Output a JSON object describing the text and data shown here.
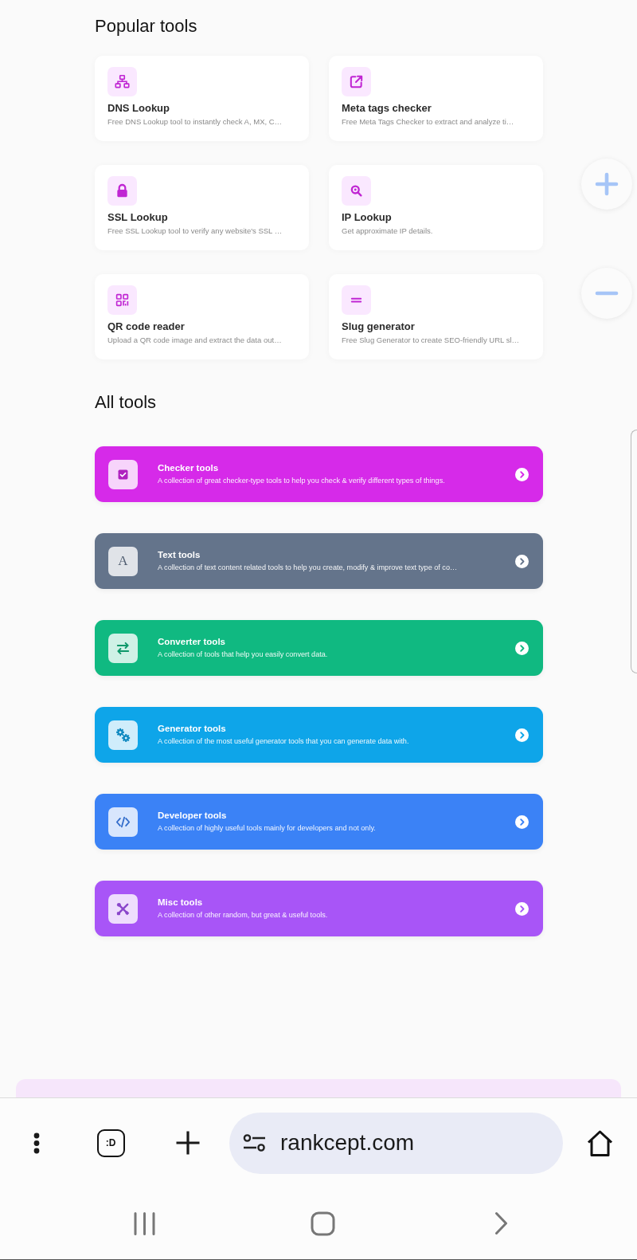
{
  "popular_tools": {
    "heading": "Popular tools",
    "items": [
      {
        "title": "DNS Lookup",
        "description": "Free DNS Lookup tool to instantly check A, MX, C…"
      },
      {
        "title": "Meta tags checker",
        "description": "Free Meta Tags Checker to extract and analyze ti…"
      },
      {
        "title": "SSL Lookup",
        "description": "Free SSL Lookup tool to verify any website's SSL …"
      },
      {
        "title": "IP Lookup",
        "description": "Get approximate IP details."
      },
      {
        "title": "QR code reader",
        "description": "Upload a QR code image and extract the data out…"
      },
      {
        "title": "Slug generator",
        "description": "Free Slug Generator to create SEO-friendly URL sl…"
      }
    ]
  },
  "all_tools": {
    "heading": "All tools",
    "items": [
      {
        "title": "Checker tools",
        "description": "A collection of great checker-type tools to help you check & verify different types of things.",
        "color": "#d62ae9"
      },
      {
        "title": "Text tools",
        "description": "A collection of text content related tools to help you create, modify & improve text type of co…",
        "color": "#64748b",
        "icon_text": "A"
      },
      {
        "title": "Converter tools",
        "description": "A collection of tools that help you easily convert data.",
        "color": "#10b981"
      },
      {
        "title": "Generator tools",
        "description": "A collection of the most useful generator tools that you can generate data with.",
        "color": "#0ea5e9"
      },
      {
        "title": "Developer tools",
        "description": "A collection of highly useful tools mainly for developers and not only.",
        "color": "#3b82f6"
      },
      {
        "title": "Misc tools",
        "description": "A collection of other random, but great & useful tools.",
        "color": "#a855f7"
      }
    ]
  },
  "browser_toolbar": {
    "tab_label": ":D",
    "url": "rankcept.com"
  }
}
